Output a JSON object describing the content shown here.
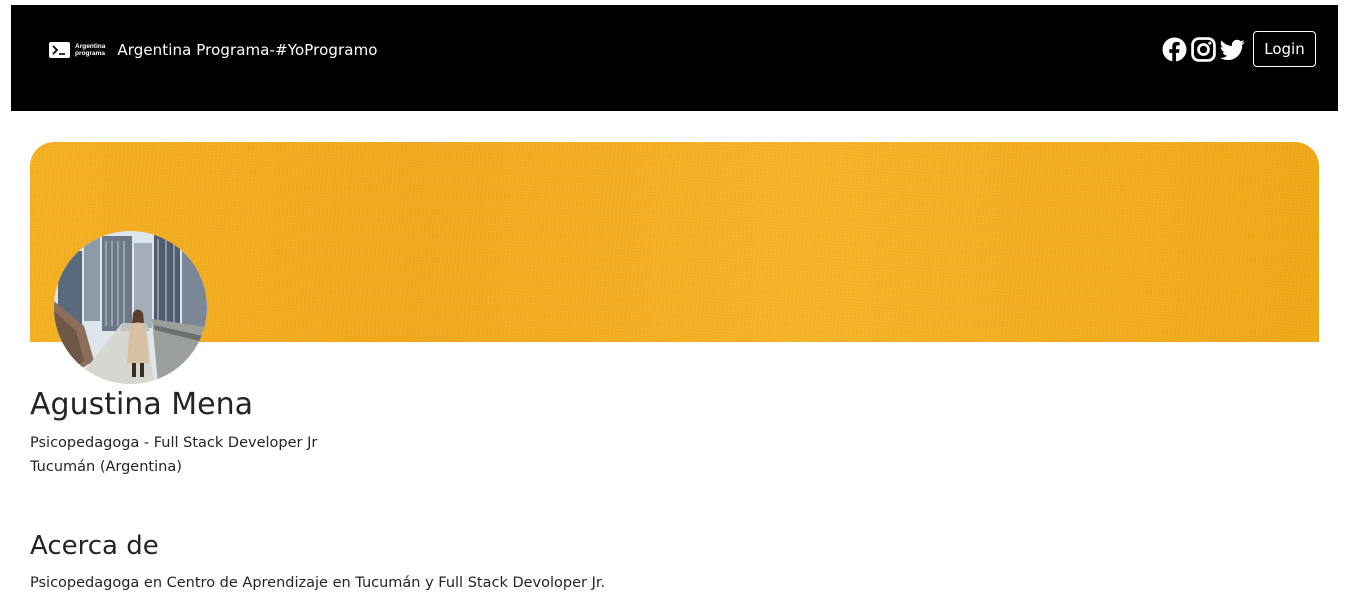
{
  "navbar": {
    "logo_text_line1": "Argentina",
    "logo_text_line2": "programa",
    "brand_title": "Argentina Programa-#YoProgramo",
    "social_icons": [
      "facebook-icon",
      "instagram-icon",
      "twitter-icon"
    ],
    "login_label": "Login",
    "background": "#000000"
  },
  "banner": {
    "color": "#f5b122"
  },
  "profile": {
    "name": "Agustina Mena",
    "subtitle": "Psicopedagoga - Full Stack Developer Jr",
    "location": "Tucumán (Argentina)"
  },
  "about": {
    "title": "Acerca de",
    "text": "Psicopedagoga en Centro de Aprendizaje en Tucumán y Full Stack Devoloper Jr."
  }
}
